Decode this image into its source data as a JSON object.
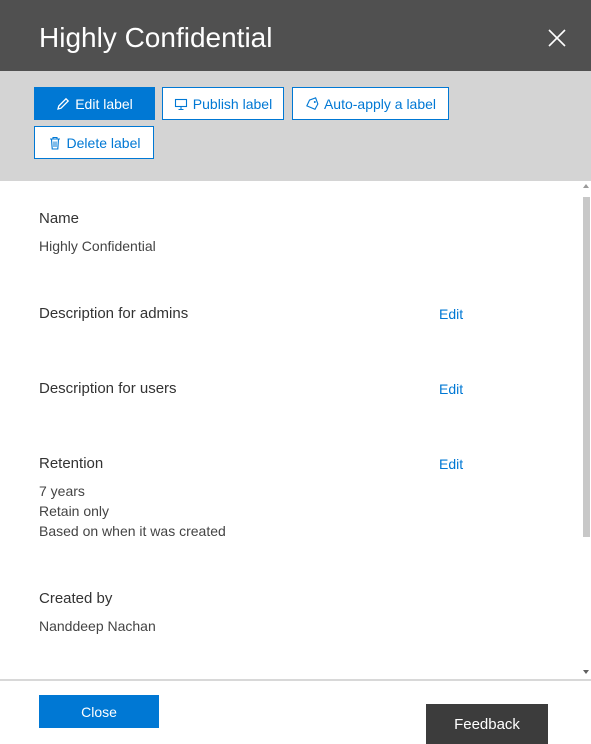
{
  "panel": {
    "title": "Highly Confidential"
  },
  "toolbar": {
    "edit_label": "Edit label",
    "publish_label": "Publish label",
    "auto_apply_label": "Auto-apply a label",
    "delete_label": "Delete label"
  },
  "details": {
    "name": {
      "title": "Name",
      "value": "Highly Confidential"
    },
    "description_admins": {
      "title": "Description for admins",
      "edit": "Edit"
    },
    "description_users": {
      "title": "Description for users",
      "edit": "Edit"
    },
    "retention": {
      "title": "Retention",
      "edit": "Edit",
      "lines": [
        "7 years",
        "Retain only",
        "Based on when it was created"
      ]
    },
    "created_by": {
      "title": "Created by",
      "value": "Nanddeep Nachan"
    }
  },
  "footer": {
    "close_label": "Close",
    "feedback_label": "Feedback"
  },
  "colors": {
    "header_bg": "#505050",
    "toolbar_bg": "#d4d4d4",
    "accent": "#0078d4",
    "feedback_bg": "#3c3c3c"
  },
  "icons": {
    "close": "close-icon",
    "edit": "pencil-icon",
    "publish": "publish-icon",
    "auto_apply": "tag-icon",
    "delete": "trash-icon"
  }
}
